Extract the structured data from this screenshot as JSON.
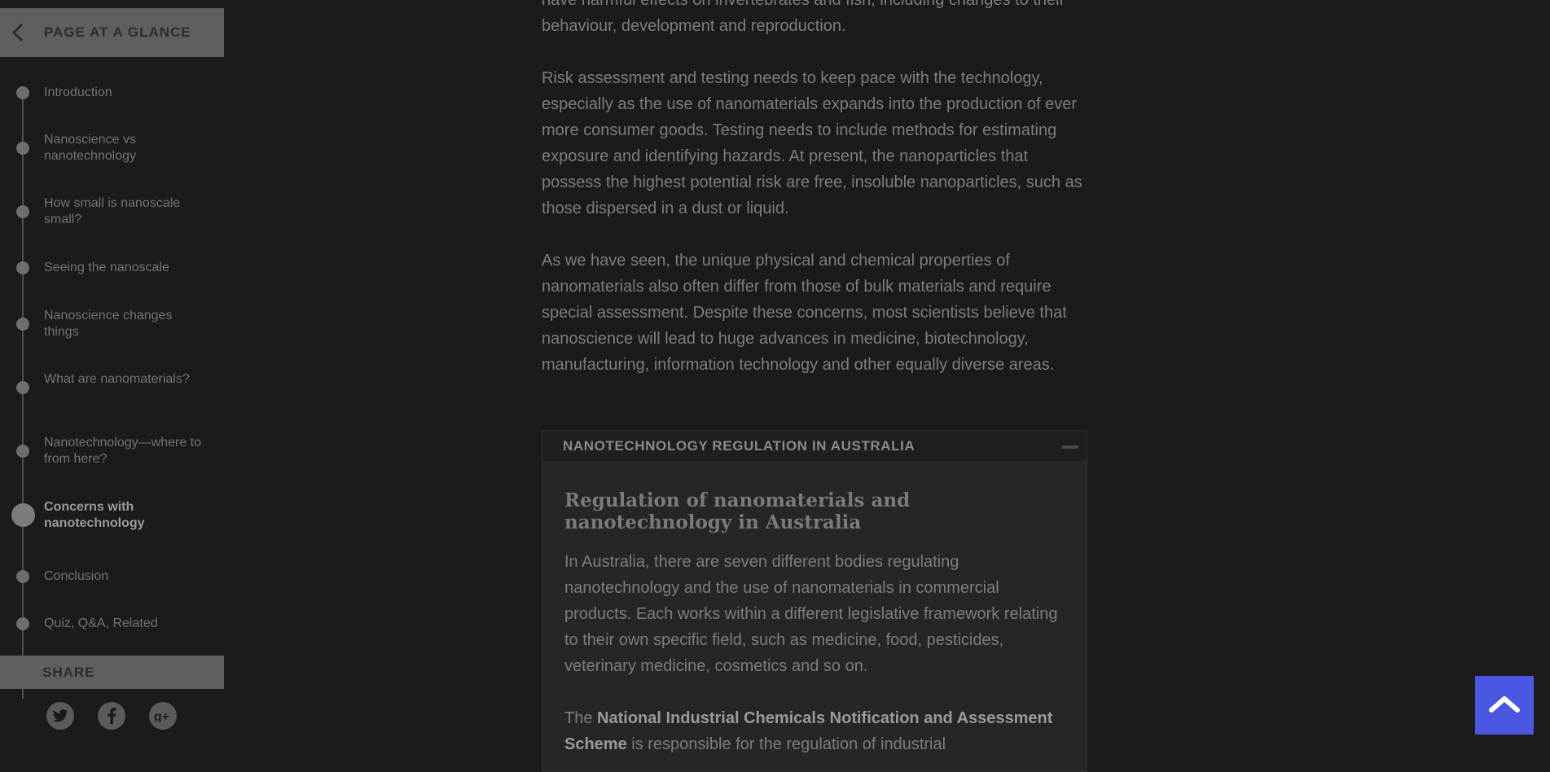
{
  "sidebar": {
    "header_title": "PAGE AT A GLANCE",
    "toc": [
      {
        "label": "Introduction",
        "active": false
      },
      {
        "label": "Nanoscience vs nanotechnology",
        "active": false
      },
      {
        "label": "How small is nanoscale small?",
        "active": false
      },
      {
        "label": "Seeing the nanoscale",
        "active": false
      },
      {
        "label": "Nanoscience changes things",
        "active": false
      },
      {
        "label": "What are nanomaterials?",
        "active": false
      },
      {
        "label": "Nanotechnology—where to from here?",
        "active": false
      },
      {
        "label": "Concerns with nanotechnology",
        "active": true
      },
      {
        "label": "Conclusion",
        "active": false
      },
      {
        "label": "Quiz, Q&A, Related",
        "active": false
      }
    ],
    "share_label": "SHARE",
    "social": [
      "twitter-icon",
      "facebook-icon",
      "google-plus-icon"
    ]
  },
  "main": {
    "p0": "have harmful effects on invertebrates and fish, including changes to their behaviour, development and reproduction.",
    "p1": "Risk assessment and testing needs to keep pace with the technology, especially as the use of nanomaterials expands into the production of ever more consumer goods. Testing needs to include methods for estimating exposure and identifying hazards. At present, the nanoparticles that possess the highest potential risk are free, insoluble nanoparticles, such as those dispersed in a dust or liquid.",
    "p2": "As we have seen, the unique physical and chemical properties of nanomaterials also often differ from those of bulk materials and require special assessment. Despite these concerns, most scientists believe that nanoscience will lead to huge advances in medicine, biotechnology, manufacturing, information technology and other equally diverse areas.",
    "accordion": {
      "title": "NANOTECHNOLOGY REGULATION IN AUSTRALIA",
      "heading": "Regulation of nanomaterials and nanotechnology in Australia",
      "p1": "In Australia, there are seven different bodies regulating nanotechnology and the use of nanomaterials in commercial products. Each works within a different legislative framework relating to their own specific field, such as medicine, food, pesticides, veterinary medicine, cosmetics and so on.",
      "p2_prefix": "The ",
      "p2_bold": "National Industrial Chemicals Notification and Assessment Scheme",
      "p2_suffix": " is responsible for the regulation of industrial"
    }
  },
  "colors": {
    "background": "#1b1b1c",
    "sidebar_header": "#5f5f5f",
    "back_to_top": "#4a57e0"
  }
}
